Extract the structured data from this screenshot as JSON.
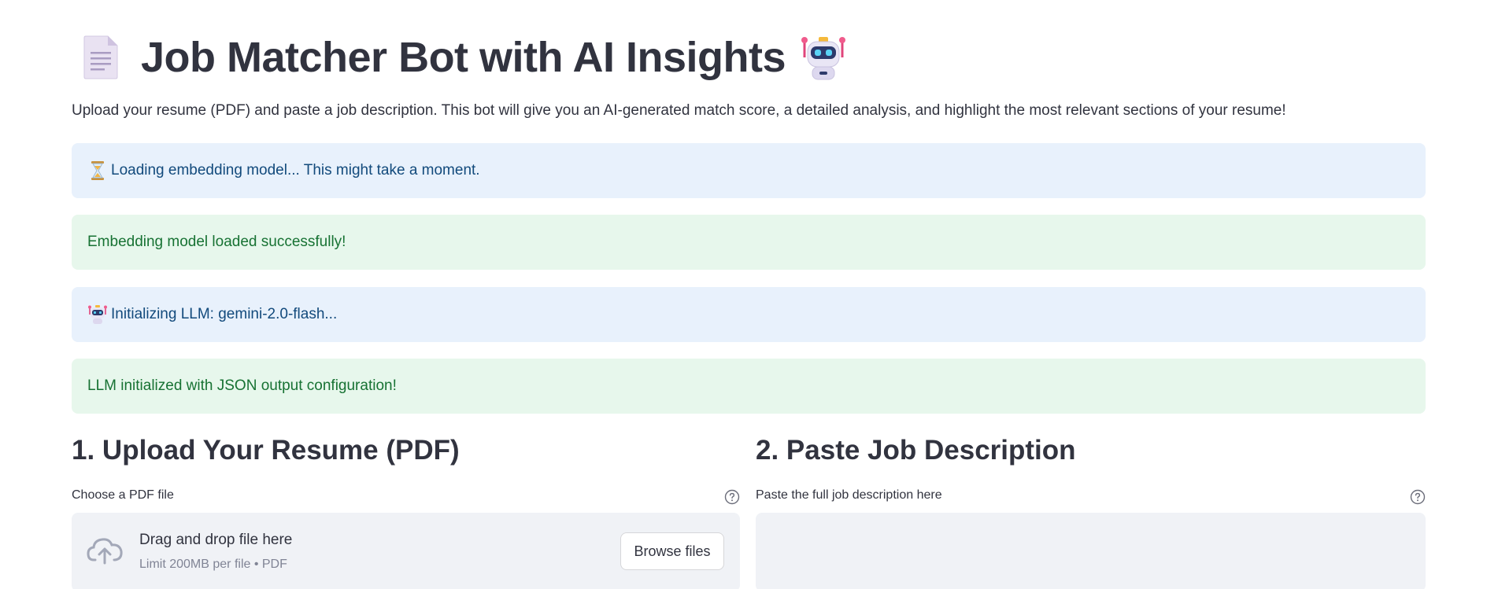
{
  "header": {
    "title": "Job Matcher Bot with AI Insights",
    "doc_icon": "page-document-icon",
    "robot_icon": "robot-icon"
  },
  "intro": {
    "text": "Upload your resume (PDF) and paste a job description. This bot will give you an AI-generated match score, a detailed analysis, and highlight the most relevant sections of your resume!"
  },
  "alerts": [
    {
      "type": "info",
      "icon": "hourglass-icon",
      "text": "Loading embedding model... This might take a moment."
    },
    {
      "type": "success",
      "icon": "",
      "text": "Embedding model loaded successfully!"
    },
    {
      "type": "info",
      "icon": "robot-icon",
      "text": "Initializing LLM: gemini-2.0-flash..."
    },
    {
      "type": "success",
      "icon": "",
      "text": "LLM initialized with JSON output configuration!"
    }
  ],
  "upload_section": {
    "heading": "1. Upload Your Resume (PDF)",
    "label": "Choose a PDF file",
    "dropzone_title": "Drag and drop file here",
    "dropzone_limit": "Limit 200MB per file • PDF",
    "browse_label": "Browse files"
  },
  "job_section": {
    "heading": "2. Paste Job Description",
    "label": "Paste the full job description here",
    "textarea_value": ""
  },
  "colors": {
    "info_bg": "#e8f1fc",
    "info_text": "#124a7c",
    "success_bg": "#e7f7ec",
    "success_text": "#177233",
    "input_bg": "#f0f2f6"
  }
}
